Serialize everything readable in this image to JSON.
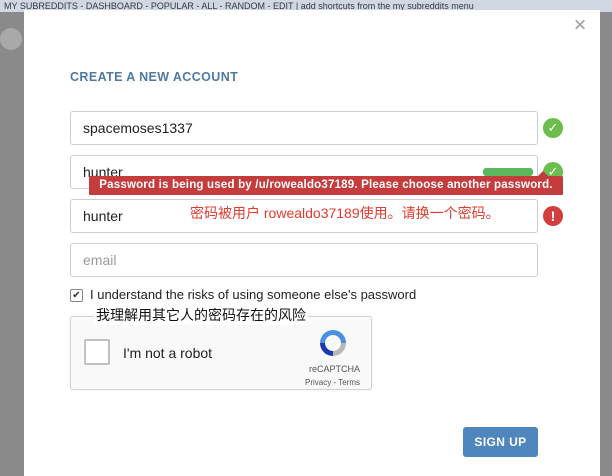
{
  "topbar": {
    "text": "MY SUBREDDITS - DASHBOARD - POPULAR - ALL - RANDOM - EDIT | add shortcuts from the my subreddits menu"
  },
  "modal": {
    "heading": "CREATE A NEW ACCOUNT",
    "close_icon": "×"
  },
  "form": {
    "username": {
      "value": "spacemoses1337",
      "status": "ok"
    },
    "password": {
      "value": "hunter",
      "status": "ok",
      "strength_bar": "strong"
    },
    "verify_password": {
      "value": "hunter",
      "status": "error"
    },
    "email": {
      "value": "",
      "placeholder": "email"
    },
    "error_tooltip": "Password is being used by /u/rowealdo37189. Please choose another password.",
    "annotation_error": "密码被用户 rowealdo37189使用。请换一个密码。",
    "risk_checkbox": {
      "checked": true,
      "label": "I understand the risks of using someone else's password"
    },
    "annotation_checkbox": "我理解用其它人的密码存在的风险",
    "recaptcha": {
      "label": "I'm not a robot",
      "brand": "reCAPTCHA",
      "terms": "Privacy - Terms"
    },
    "submit_label": "SIGN UP"
  },
  "icons": {
    "ok": "check-circle-icon",
    "error": "exclamation-circle-icon"
  },
  "colors": {
    "heading": "#4f7aa3",
    "ok": "#6bbd4d",
    "error": "#d13e3e",
    "button": "#4f86bd",
    "annotation": "#e33b2e"
  }
}
